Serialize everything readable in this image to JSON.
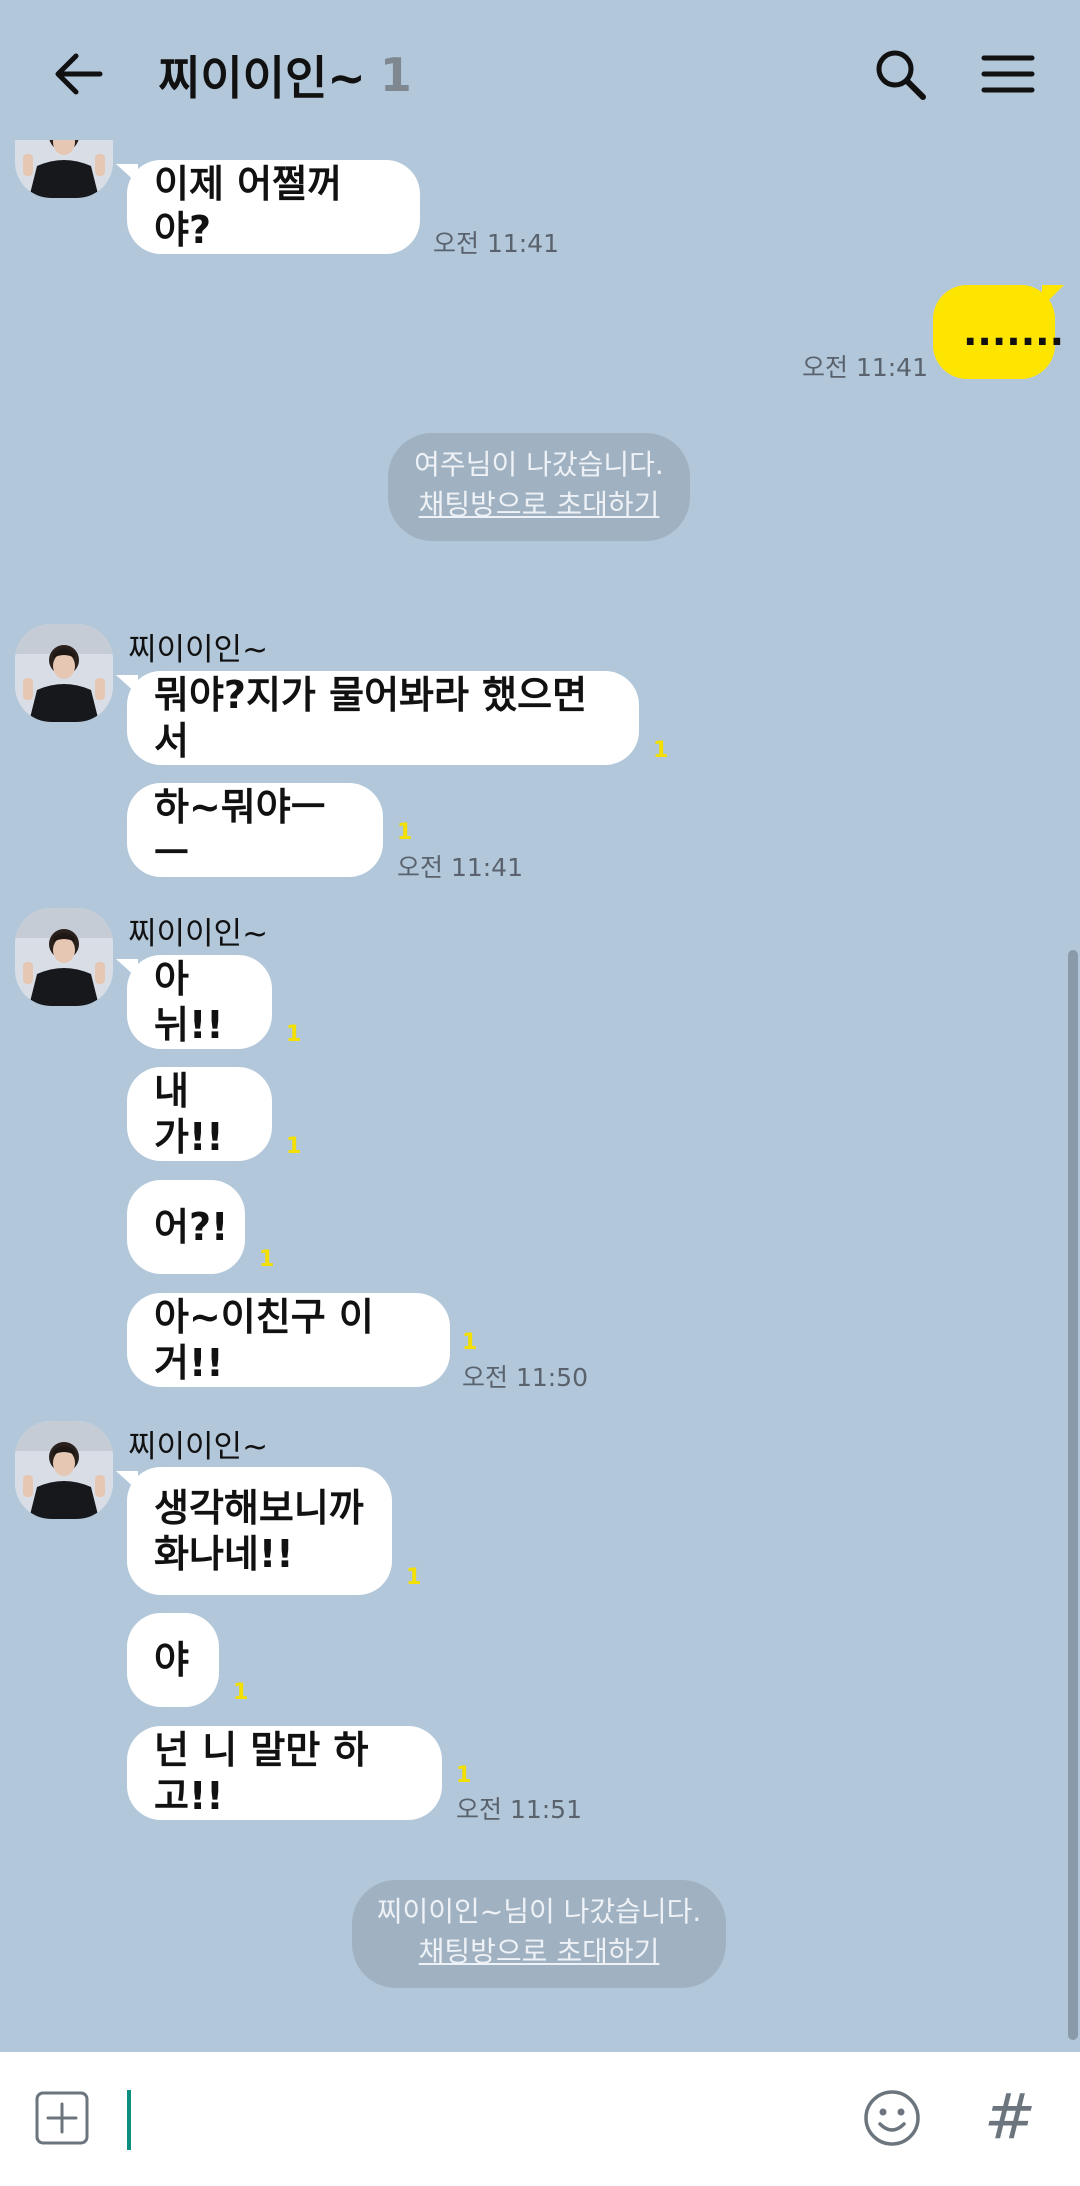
{
  "header": {
    "title": "찌이이인~",
    "member_count": "1"
  },
  "system_notices": [
    {
      "text": "여주님이 나갔습니다.",
      "invite": "채팅방으로 초대하기"
    },
    {
      "text": "찌이이인~님이 나갔습니다.",
      "invite": "채팅방으로 초대하기"
    }
  ],
  "messages": {
    "m0": {
      "text": "이제 어쩔꺼야?",
      "time": "오전 11:41"
    },
    "mine": {
      "text": ".......",
      "time": "오전 11:41"
    },
    "g1": {
      "sender": "찌이이인~",
      "items": [
        {
          "text": "뭐야?지가 물어봐라 했으면서",
          "unread": "1"
        },
        {
          "text": "하~뭐야ㅡㅡ",
          "unread": "1",
          "time": "오전 11:41"
        }
      ]
    },
    "g2": {
      "sender": "찌이이인~",
      "items": [
        {
          "text": "아뉘!!",
          "unread": "1"
        },
        {
          "text": "내가!!",
          "unread": "1"
        },
        {
          "text": "어?!",
          "unread": "1"
        },
        {
          "text": "아~이친구 이거!!",
          "unread": "1",
          "time": "오전 11:50"
        }
      ]
    },
    "g3": {
      "sender": "찌이이인~",
      "items": [
        {
          "line1": "생각해보니까",
          "line2": "화나네!!",
          "unread": "1"
        },
        {
          "text": "야",
          "unread": "1"
        },
        {
          "text": "넌 니 말만 하고!!",
          "unread": "1",
          "time": "오전 11:51"
        }
      ]
    }
  },
  "icons": {
    "back": "arrow-left-icon",
    "search": "search-icon",
    "menu": "hamburger-menu-icon",
    "plus": "plus-square-icon",
    "emoji": "smiley-icon",
    "hash": "hashtag-icon"
  },
  "input": {
    "hash_symbol": "#"
  },
  "colors": {
    "background": "#b2c7da",
    "my_bubble": "#fee500",
    "unread": "#f3e000",
    "caret": "#0d8f7f"
  }
}
